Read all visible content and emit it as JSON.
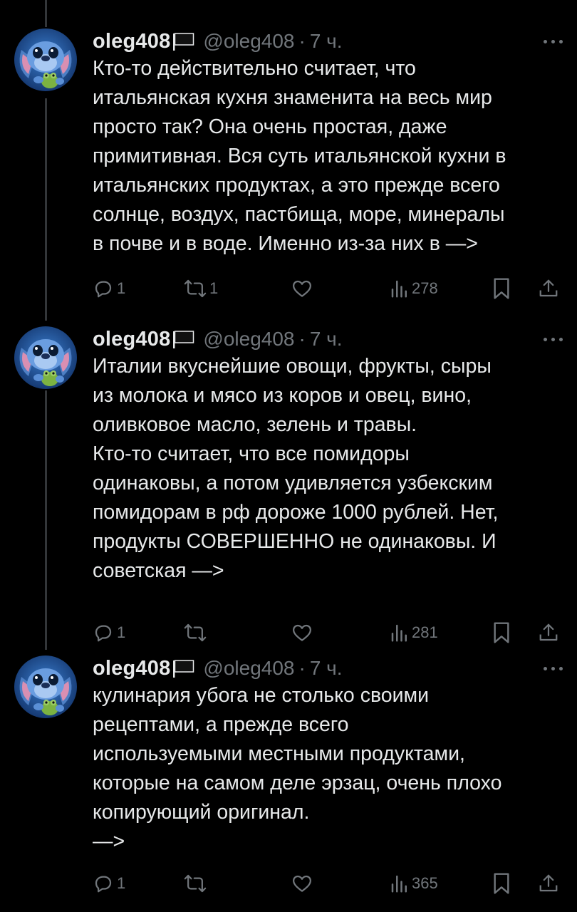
{
  "tweets": [
    {
      "name": "oleg408",
      "handle": "@oleg408",
      "time": "7 ч.",
      "text": "Кто-то действительно считает, что\nитальянская кухня знаменита на весь мир\nпросто так? Она очень простая, даже\nпримитивная. Вся суть итальянской кухни в\nитальянских продуктах, а это прежде всего\nсолнце, воздух, пастбища, море, минералы\nв почве и в воде. Именно из-за них в —>",
      "replies": "1",
      "reposts": "1",
      "likes": "",
      "views": "278"
    },
    {
      "name": "oleg408",
      "handle": "@oleg408",
      "time": "7 ч.",
      "text": "Италии вкуснейшие овощи, фрукты, сыры\nиз молока и мясо из коров и овец, вино,\nоливковое масло, зелень и травы.\nКто-то считает, что все помидоры\nодинаковы, а потом удивляется узбекским\nпомидорам в рф дороже 1000 рублей. Нет,\nпродукты СОВЕРШЕННО не одинаковы. И\nсоветская —>",
      "replies": "1",
      "reposts": "",
      "likes": "",
      "views": "281"
    },
    {
      "name": "oleg408",
      "handle": "@oleg408",
      "time": "7 ч.",
      "text": "кулинария убога не столько своими\nрецептами, а прежде всего\nиспользуемыми местными продуктами,\nкоторые на самом деле эрзац, очень плохо\nкопирующий оригинал.\n—>",
      "replies": "1",
      "reposts": "",
      "likes": "",
      "views": "365"
    }
  ],
  "icons": {
    "reply": "reply-icon",
    "repost": "repost-icon",
    "like": "heart-icon",
    "views": "views-icon",
    "bookmark": "bookmark-icon",
    "share": "share-icon",
    "more": "more-icon",
    "flag": "black-flag-icon"
  },
  "colors": {
    "background": "#000000",
    "text": "#e7e9ea",
    "secondary": "#71767b",
    "thread_line": "#333639",
    "avatar_bg": "#1e4a8c"
  }
}
